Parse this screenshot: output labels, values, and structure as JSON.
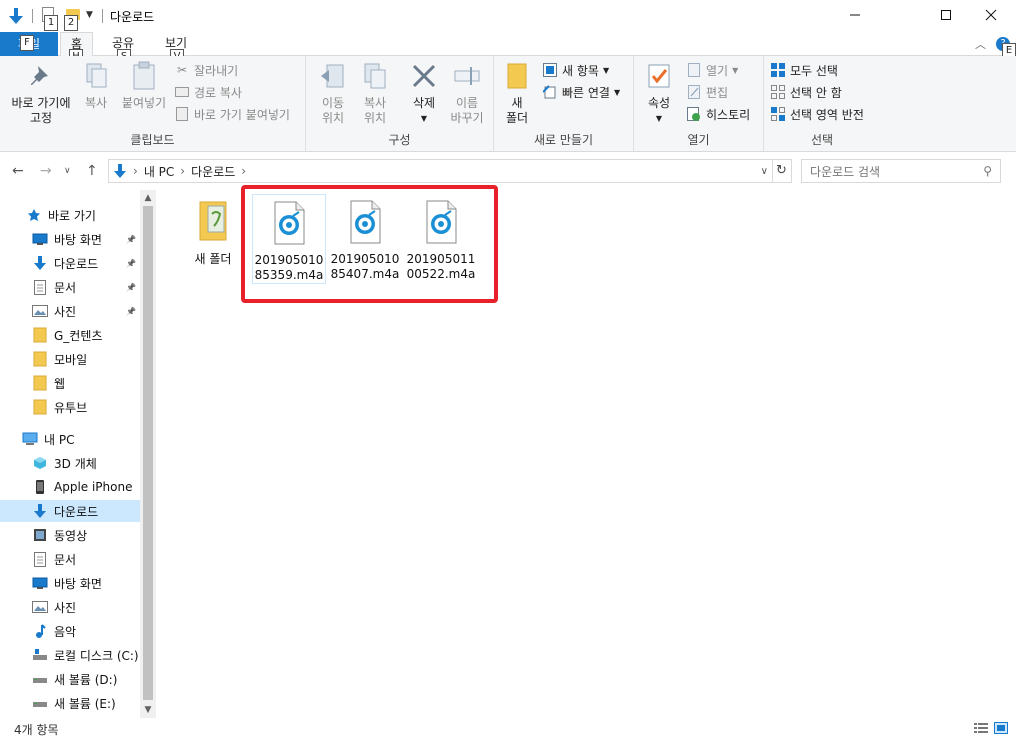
{
  "window": {
    "title": "다운로드",
    "keytips": {
      "qa1": "1",
      "qa2": "2",
      "file": "F",
      "home": "H",
      "share": "S",
      "view": "V",
      "help": "E"
    }
  },
  "tabs": {
    "file": "파일",
    "home": "홈",
    "share": "공유",
    "view": "보기"
  },
  "ribbon": {
    "clipboard": {
      "label": "클립보드",
      "pin": "바로 가기에\n고정",
      "copy": "복사",
      "paste": "붙여넣기",
      "cut": "잘라내기",
      "copy_path": "경로 복사",
      "paste_shortcut": "바로 가기 붙여넣기"
    },
    "organize": {
      "label": "구성",
      "move_to": "이동\n위치",
      "copy_to": "복사\n위치",
      "delete": "삭제",
      "rename": "이름\n바꾸기"
    },
    "new": {
      "label": "새로 만들기",
      "new_folder": "새\n폴더",
      "new_item": "새 항목",
      "easy_access": "빠른 연결"
    },
    "open": {
      "label": "열기",
      "properties": "속성",
      "open": "열기",
      "edit": "편집",
      "history": "히스토리"
    },
    "select": {
      "label": "선택",
      "select_all": "모두 선택",
      "select_none": "선택 안 함",
      "invert": "선택 영역 반전"
    }
  },
  "address": {
    "crumbs": [
      "내 PC",
      "다운로드"
    ],
    "search_placeholder": "다운로드 검색"
  },
  "sidebar": {
    "quick_access": "바로 가기",
    "quick_items": [
      {
        "label": "바탕 화면",
        "pinned": true
      },
      {
        "label": "다운로드",
        "pinned": true
      },
      {
        "label": "문서",
        "pinned": true
      },
      {
        "label": "사진",
        "pinned": true
      },
      {
        "label": "G_컨텐츠",
        "pinned": false
      },
      {
        "label": "모바일",
        "pinned": false
      },
      {
        "label": "웹",
        "pinned": false
      },
      {
        "label": "유투브",
        "pinned": false
      }
    ],
    "this_pc": "내 PC",
    "pc_items": [
      {
        "label": "3D 개체"
      },
      {
        "label": "Apple iPhone"
      },
      {
        "label": "다운로드",
        "selected": true
      },
      {
        "label": "동영상"
      },
      {
        "label": "문서"
      },
      {
        "label": "바탕 화면"
      },
      {
        "label": "사진"
      },
      {
        "label": "음악"
      },
      {
        "label": "로컬 디스크 (C:)"
      },
      {
        "label": "새 볼륨 (D:)"
      },
      {
        "label": "새 볼륨 (E:)"
      }
    ]
  },
  "files": [
    {
      "name": "새 폴더",
      "type": "folder"
    },
    {
      "name": "20190501085359.m4a",
      "type": "audio"
    },
    {
      "name": "20190501085407.m4a",
      "type": "audio"
    },
    {
      "name": "20190501100522.m4a",
      "type": "audio"
    }
  ],
  "status": {
    "count": "4개 항목"
  },
  "colors": {
    "accent": "#1979ca",
    "highlight_border": "#e8202a",
    "selection": "#cce8ff",
    "folder": "#f3c94f",
    "audio_icon": "#1b8fd6"
  }
}
